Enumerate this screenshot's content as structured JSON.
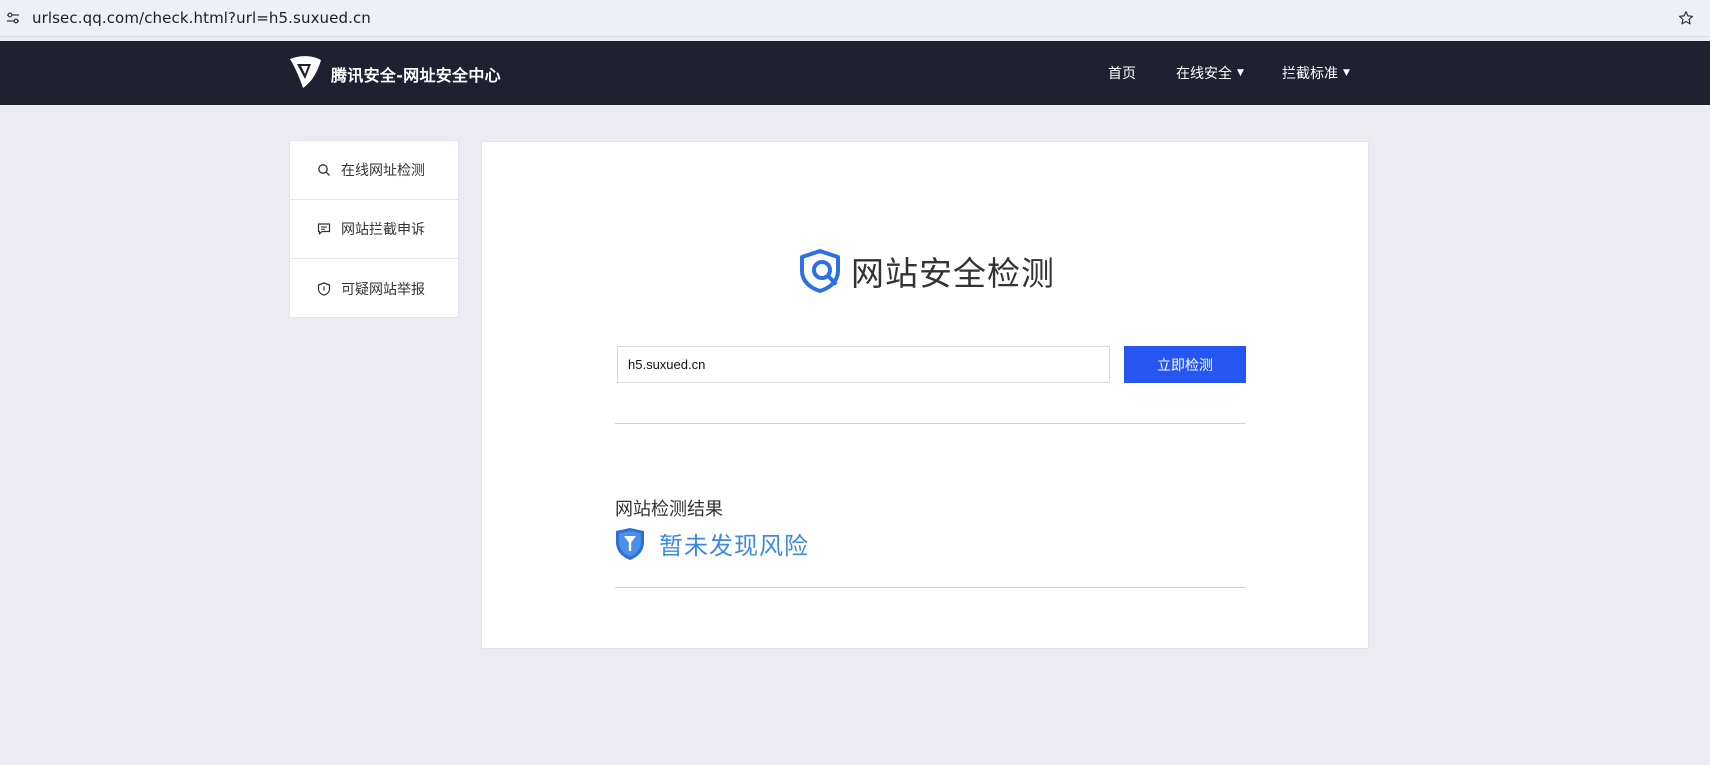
{
  "browser": {
    "url": "urlsec.qq.com/check.html?url=h5.suxued.cn"
  },
  "nav": {
    "brand": "腾讯安全-网址安全中心",
    "items": [
      {
        "label": "首页"
      },
      {
        "label": "在线安全"
      },
      {
        "label": "拦截标准"
      }
    ]
  },
  "sidebar": {
    "items": [
      {
        "label": "在线网址检测",
        "icon": "search-icon"
      },
      {
        "label": "网站拦截申诉",
        "icon": "chat-icon"
      },
      {
        "label": "可疑网站举报",
        "icon": "shield-icon"
      }
    ]
  },
  "main": {
    "headline": "网站安全检测",
    "input_value": "h5.suxued.cn",
    "check_button": "立即检测",
    "result_label": "网站检测结果",
    "result_status": "暂未发现风险"
  },
  "colors": {
    "nav_bg": "#1f2130",
    "accent_button": "#2656f2",
    "result_blue": "#3f8ae0",
    "page_bg": "#ecebf1"
  }
}
